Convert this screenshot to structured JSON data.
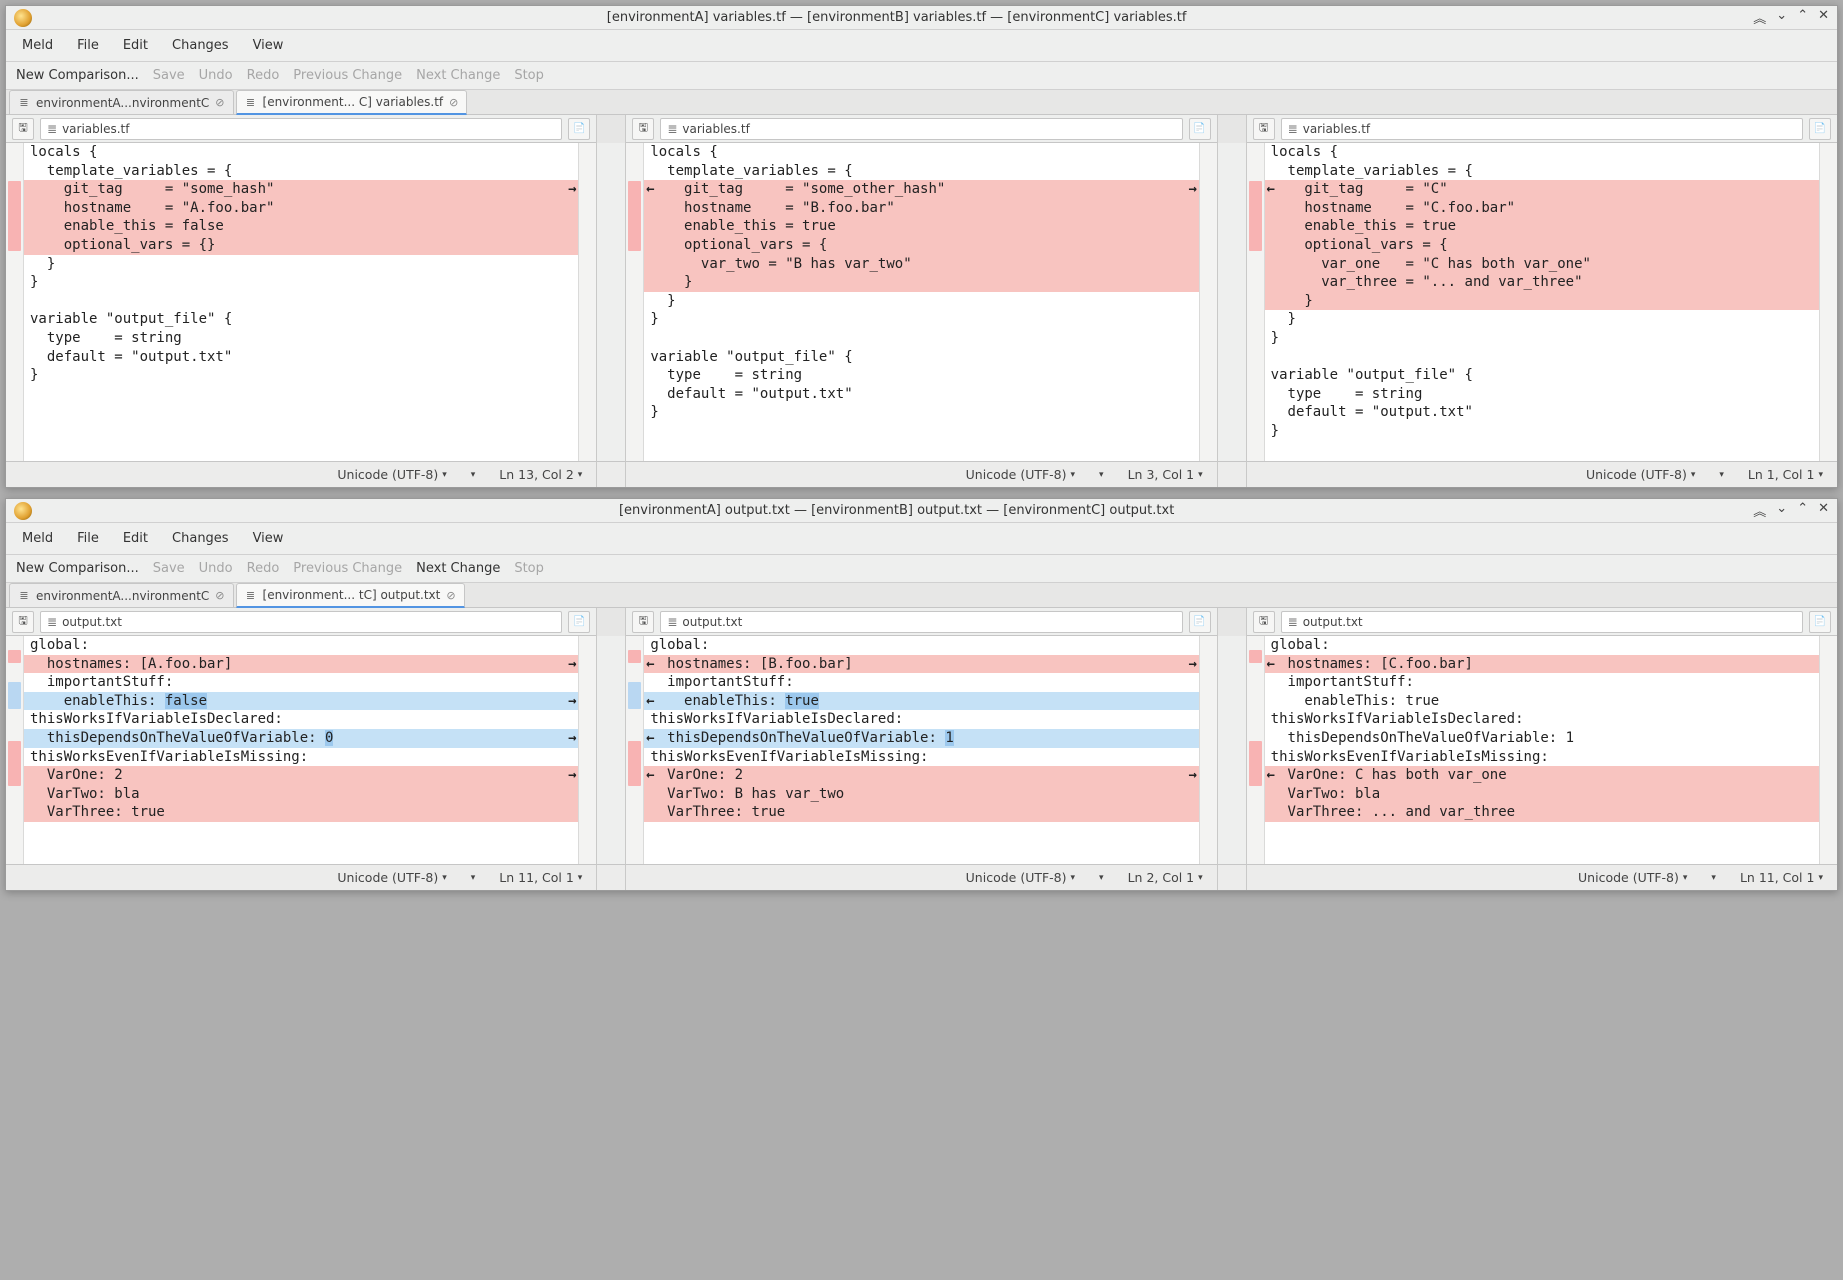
{
  "windows": [
    {
      "title": "[environmentA] variables.tf — [environmentB] variables.tf — [environmentC] variables.tf",
      "menus": [
        "Meld",
        "File",
        "Edit",
        "Changes",
        "View"
      ],
      "toolbar": [
        {
          "label": "New Comparison...",
          "enabled": true
        },
        {
          "label": "Save",
          "enabled": false
        },
        {
          "label": "Undo",
          "enabled": false
        },
        {
          "label": "Redo",
          "enabled": false
        },
        {
          "label": "Previous Change",
          "enabled": false
        },
        {
          "label": "Next Change",
          "enabled": false
        },
        {
          "label": "Stop",
          "enabled": false
        }
      ],
      "tabs": [
        {
          "label": "environmentA...nvironmentC",
          "active": false
        },
        {
          "label": "[environment... C] variables.tf",
          "active": true
        }
      ],
      "panes": [
        {
          "filename": "variables.tf",
          "lines": [
            {
              "t": "locals {",
              "c": ""
            },
            {
              "t": "  template_variables = {",
              "c": ""
            },
            {
              "t": "    git_tag     = \"some_hash\"",
              "c": "red",
              "ar": true
            },
            {
              "t": "    hostname    = \"A.foo.bar\"",
              "c": "red"
            },
            {
              "t": "    enable_this = false",
              "c": "red"
            },
            {
              "t": "    optional_vars = {}",
              "c": "red"
            },
            {
              "t": "  }",
              "c": ""
            },
            {
              "t": "}",
              "c": ""
            },
            {
              "t": "",
              "c": ""
            },
            {
              "t": "variable \"output_file\" {",
              "c": ""
            },
            {
              "t": "  type    = string",
              "c": ""
            },
            {
              "t": "  default = \"output.txt\"",
              "c": ""
            },
            {
              "t": "}",
              "c": ""
            }
          ],
          "status": {
            "enc": "Unicode (UTF-8)",
            "pos": "Ln 13, Col 2"
          }
        },
        {
          "filename": "variables.tf",
          "lines": [
            {
              "t": "locals {",
              "c": ""
            },
            {
              "t": "  template_variables = {",
              "c": ""
            },
            {
              "t": "    git_tag     = \"some_other_hash\"",
              "c": "red",
              "al": true,
              "ar": true
            },
            {
              "t": "    hostname    = \"B.foo.bar\"",
              "c": "red"
            },
            {
              "t": "    enable_this = true",
              "c": "red"
            },
            {
              "t": "    optional_vars = {",
              "c": "red"
            },
            {
              "t": "      var_two = \"B has var_two\"",
              "c": "red"
            },
            {
              "t": "    }",
              "c": "red"
            },
            {
              "t": "  }",
              "c": ""
            },
            {
              "t": "}",
              "c": ""
            },
            {
              "t": "",
              "c": ""
            },
            {
              "t": "variable \"output_file\" {",
              "c": ""
            },
            {
              "t": "  type    = string",
              "c": ""
            },
            {
              "t": "  default = \"output.txt\"",
              "c": ""
            },
            {
              "t": "}",
              "c": ""
            }
          ],
          "status": {
            "enc": "Unicode (UTF-8)",
            "pos": "Ln 3, Col 1"
          }
        },
        {
          "filename": "variables.tf",
          "lines": [
            {
              "t": "locals {",
              "c": ""
            },
            {
              "t": "  template_variables = {",
              "c": ""
            },
            {
              "t": "    git_tag     = \"C\"",
              "c": "red",
              "al": true
            },
            {
              "t": "    hostname    = \"C.foo.bar\"",
              "c": "red"
            },
            {
              "t": "    enable_this = true",
              "c": "red"
            },
            {
              "t": "    optional_vars = {",
              "c": "red"
            },
            {
              "t": "      var_one   = \"C has both var_one\"",
              "c": "red"
            },
            {
              "t": "      var_three = \"... and var_three\"",
              "c": "red"
            },
            {
              "t": "    }",
              "c": "red"
            },
            {
              "t": "  }",
              "c": ""
            },
            {
              "t": "}",
              "c": ""
            },
            {
              "t": "",
              "c": ""
            },
            {
              "t": "variable \"output_file\" {",
              "c": ""
            },
            {
              "t": "  type    = string",
              "c": ""
            },
            {
              "t": "  default = \"output.txt\"",
              "c": ""
            },
            {
              "t": "}",
              "c": ""
            }
          ],
          "status": {
            "enc": "Unicode (UTF-8)",
            "pos": "Ln 1, Col 1"
          }
        }
      ]
    },
    {
      "title": "[environmentA] output.txt — [environmentB] output.txt — [environmentC] output.txt",
      "menus": [
        "Meld",
        "File",
        "Edit",
        "Changes",
        "View"
      ],
      "toolbar": [
        {
          "label": "New Comparison...",
          "enabled": true
        },
        {
          "label": "Save",
          "enabled": false
        },
        {
          "label": "Undo",
          "enabled": false
        },
        {
          "label": "Redo",
          "enabled": false
        },
        {
          "label": "Previous Change",
          "enabled": false
        },
        {
          "label": "Next Change",
          "enabled": true
        },
        {
          "label": "Stop",
          "enabled": false
        }
      ],
      "tabs": [
        {
          "label": "environmentA...nvironmentC",
          "active": false
        },
        {
          "label": "[environment... tC] output.txt",
          "active": true
        }
      ],
      "panes": [
        {
          "filename": "output.txt",
          "lines": [
            {
              "t": "global:",
              "c": ""
            },
            {
              "t": "  hostnames: [A.foo.bar]",
              "c": "red",
              "ar": true
            },
            {
              "t": "  importantStuff:",
              "c": ""
            },
            {
              "t": "    enableThis: false",
              "c": "blue",
              "ar": true,
              "hl": [
                16,
                21
              ]
            },
            {
              "t": "thisWorksIfVariableIsDeclared:",
              "c": ""
            },
            {
              "t": "  thisDependsOnTheValueOfVariable: 0",
              "c": "blue",
              "ar": true,
              "hl": [
                35,
                36
              ]
            },
            {
              "t": "thisWorksEvenIfVariableIsMissing:",
              "c": ""
            },
            {
              "t": "  VarOne: 2",
              "c": "red",
              "ar": true
            },
            {
              "t": "  VarTwo: bla",
              "c": "red"
            },
            {
              "t": "  VarThree: true",
              "c": "red"
            }
          ],
          "status": {
            "enc": "Unicode (UTF-8)",
            "pos": "Ln 11, Col 1"
          }
        },
        {
          "filename": "output.txt",
          "lines": [
            {
              "t": "global:",
              "c": ""
            },
            {
              "t": "  hostnames: [B.foo.bar]",
              "c": "red",
              "al": true,
              "ar": true
            },
            {
              "t": "  importantStuff:",
              "c": ""
            },
            {
              "t": "    enableThis: true",
              "c": "blue",
              "al": true,
              "hl": [
                16,
                20
              ]
            },
            {
              "t": "thisWorksIfVariableIsDeclared:",
              "c": ""
            },
            {
              "t": "  thisDependsOnTheValueOfVariable: 1",
              "c": "blue",
              "al": true,
              "hl": [
                35,
                36
              ]
            },
            {
              "t": "thisWorksEvenIfVariableIsMissing:",
              "c": ""
            },
            {
              "t": "  VarOne: 2",
              "c": "red",
              "al": true,
              "ar": true
            },
            {
              "t": "  VarTwo: B has var_two",
              "c": "red"
            },
            {
              "t": "  VarThree: true",
              "c": "red"
            }
          ],
          "status": {
            "enc": "Unicode (UTF-8)",
            "pos": "Ln 2, Col 1"
          }
        },
        {
          "filename": "output.txt",
          "lines": [
            {
              "t": "global:",
              "c": ""
            },
            {
              "t": "  hostnames: [C.foo.bar]",
              "c": "red",
              "al": true
            },
            {
              "t": "  importantStuff:",
              "c": ""
            },
            {
              "t": "    enableThis: true",
              "c": ""
            },
            {
              "t": "thisWorksIfVariableIsDeclared:",
              "c": ""
            },
            {
              "t": "  thisDependsOnTheValueOfVariable: 1",
              "c": ""
            },
            {
              "t": "thisWorksEvenIfVariableIsMissing:",
              "c": ""
            },
            {
              "t": "  VarOne: C has both var_one",
              "c": "red",
              "al": true
            },
            {
              "t": "  VarTwo: bla",
              "c": "red"
            },
            {
              "t": "  VarThree: ... and var_three",
              "c": "red"
            }
          ],
          "status": {
            "enc": "Unicode (UTF-8)",
            "pos": "Ln 11, Col 1"
          }
        }
      ]
    }
  ],
  "icons": {
    "save": "🖫",
    "file": "≣",
    "close": "⊘",
    "folder": "📁",
    "chev": "▾",
    "chevr": "▸",
    "arrow_r": "➜",
    "arrow_l": "⬅"
  },
  "window_controls": [
    "⌃",
    "⌄",
    "⌃",
    "✕"
  ]
}
